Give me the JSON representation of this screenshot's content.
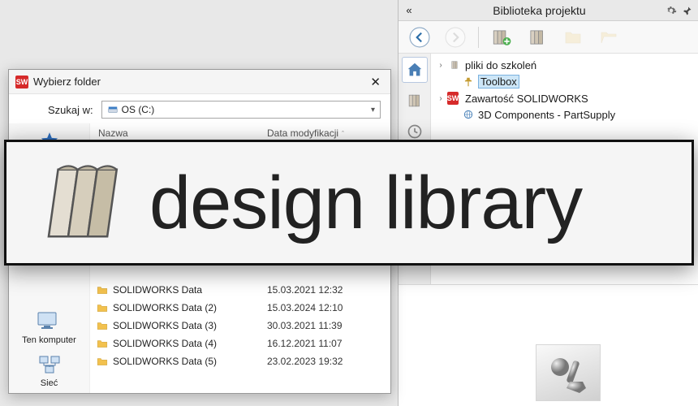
{
  "panel": {
    "title": "Biblioteka projektu",
    "toolbar": {
      "back": "Wstecz",
      "forward": "Dalej",
      "add_location": "Dodaj lokalizację",
      "library": "Biblioteka",
      "folder": "Folder",
      "open": "Otwórz"
    },
    "tree_items": [
      {
        "label": "pliki do szkoleń",
        "icon": "books",
        "expander": "›",
        "level": 1
      },
      {
        "label": "Toolbox",
        "icon": "toolbox",
        "expander": "",
        "level": 2,
        "selected": true
      },
      {
        "label": "Zawartość SOLIDWORKS",
        "icon": "sw",
        "expander": "›",
        "level": 1
      },
      {
        "label": "3D Components - PartSupply",
        "icon": "globe",
        "expander": "",
        "level": 2
      }
    ]
  },
  "dialog": {
    "title": "Wybierz folder",
    "search_label": "Szukaj w:",
    "search_value": "OS (C:)",
    "columns": {
      "name": "Nazwa",
      "date": "Data modyfikacji"
    },
    "places": [
      {
        "label": "",
        "icon": "star"
      },
      {
        "label": "Ten komputer",
        "icon": "pc"
      },
      {
        "label": "Sieć",
        "icon": "net"
      }
    ],
    "rows": [
      {
        "name": "SOLIDWORKS Data",
        "date": "15.03.2021 12:32"
      },
      {
        "name": "SOLIDWORKS Data (2)",
        "date": "15.03.2024 12:10"
      },
      {
        "name": "SOLIDWORKS Data (3)",
        "date": "30.03.2021 11:39"
      },
      {
        "name": "SOLIDWORKS Data (4)",
        "date": "16.12.2021 11:07"
      },
      {
        "name": "SOLIDWORKS Data (5)",
        "date": "23.02.2023 19:32"
      }
    ]
  },
  "banner": {
    "text": "design library"
  }
}
